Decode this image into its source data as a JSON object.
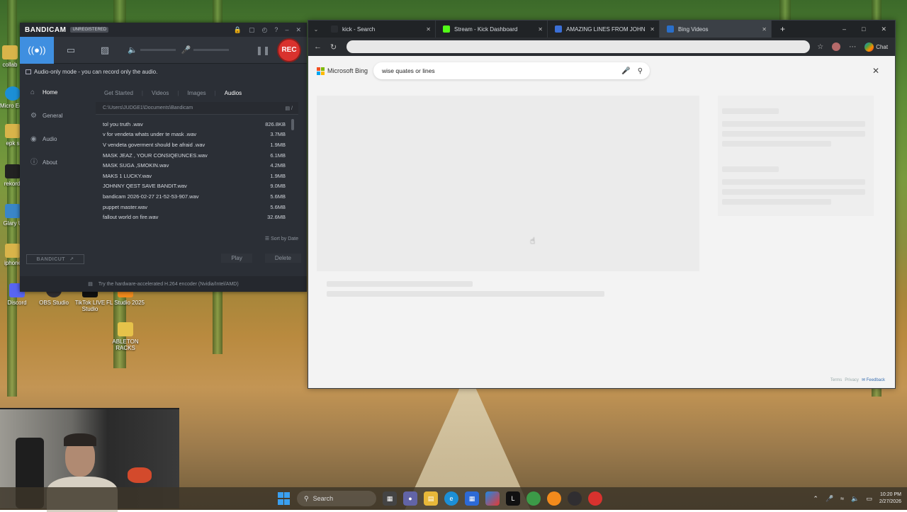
{
  "desktop": {
    "icons": [
      {
        "label": "collab",
        "color": "#d9b44a"
      },
      {
        "label": "Micro Edg",
        "color": "#1c8fd6"
      },
      {
        "label": "epk s",
        "color": "#d9b44a"
      },
      {
        "label": "rekordl",
        "color": "#222222"
      },
      {
        "label": "Glary U",
        "color": "#3a86c8"
      },
      {
        "label": "iphone",
        "color": "#d9b44a"
      },
      {
        "label": "Discord",
        "color": "#5865f2"
      },
      {
        "label": "OBS Studio",
        "color": "#302e31"
      },
      {
        "label": "TikTok LIVE Studio",
        "color": "#111111"
      },
      {
        "label": "FL Studio 2025",
        "color": "#f28a1c"
      },
      {
        "label": "ABLETON RACKS",
        "color": "#e6c24a"
      }
    ]
  },
  "bandicam": {
    "logo": "BANDICAM",
    "badge": "UNREGISTERED",
    "rec_label": "REC",
    "notice": "Audio-only mode - you can record only the audio.",
    "nav": [
      {
        "label": "Home",
        "icon": "home-icon"
      },
      {
        "label": "General",
        "icon": "gear-icon"
      },
      {
        "label": "Audio",
        "icon": "speaker-icon"
      },
      {
        "label": "About",
        "icon": "info-icon"
      }
    ],
    "tabs": [
      "Get Started",
      "Videos",
      "Images",
      "Audios"
    ],
    "active_tab": "Audios",
    "folder_path": "C:\\Users\\JUDGE1\\Documents\\Bandicam",
    "files": [
      {
        "name": "tol you truth .wav",
        "size": "826.8KB"
      },
      {
        "name": "v for vendeta whats under te mask .wav",
        "size": "3.7MB"
      },
      {
        "name": "V vendeta goverment should be afraid .wav",
        "size": "1.9MB"
      },
      {
        "name": "MASK JEAZ , YOUR CONSIQEUNCES.wav",
        "size": "6.1MB"
      },
      {
        "name": "MASK SUGA ,SMOKIN.wav",
        "size": "4.2MB"
      },
      {
        "name": "MAKS 1 LUCKY.wav",
        "size": "1.9MB"
      },
      {
        "name": "JOHNNY QEST SAVE BANDIT.wav",
        "size": "9.0MB"
      },
      {
        "name": "bandicam 2026-02-27 21-52-53-907.wav",
        "size": "5.6MB"
      },
      {
        "name": "puppet master.wav",
        "size": "5.6MB"
      },
      {
        "name": "fallout world on fire.wav",
        "size": "32.6MB"
      }
    ],
    "sort_label": "Sort by Date",
    "play_label": "Play",
    "delete_label": "Delete",
    "bandicut_label": "BANDICUT",
    "footer": "Try the hardware-accelerated H.264 encoder (Nvidia/Intel/AMD)"
  },
  "browser": {
    "tabs": [
      {
        "title": "kick - Search",
        "color": "#2a2d31"
      },
      {
        "title": "Stream - Kick Dashboard",
        "color": "#53fc18"
      },
      {
        "title": "AMAZING LINES FROM JOHNNY D",
        "color": "#3b6fd6"
      },
      {
        "title": "Bing Videos",
        "color": "#2a6fc9"
      }
    ],
    "chat_label": "Chat",
    "bing": {
      "brand": "Microsoft Bing",
      "query": "wise quates or lines",
      "terms": "Terms",
      "privacy": "Privacy",
      "feedback": "Feedback"
    }
  },
  "taskbar": {
    "search_placeholder": "Search",
    "time": "10:20 PM",
    "date": "2/27/2026"
  }
}
